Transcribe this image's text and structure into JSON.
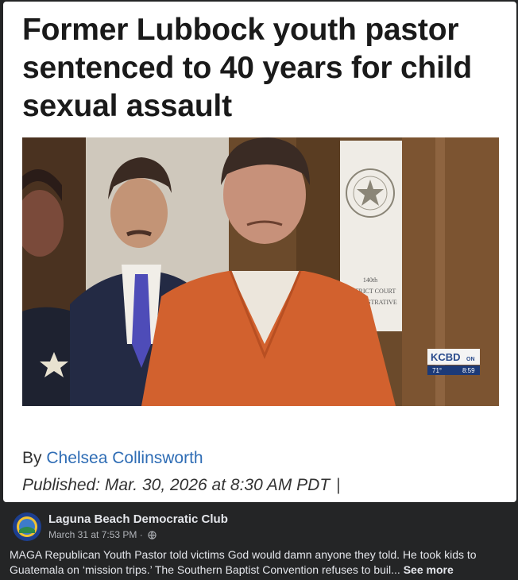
{
  "article": {
    "headline": "Former Lubbock youth pastor sentenced to 40 years for child sexual assault",
    "byline_prefix": "By",
    "author": "Chelsea Collinsworth",
    "published": "Published: Mar. 30, 2026 at 8:30 AM PDT",
    "published_separator": "|",
    "photo": {
      "station_logo": "KCBD",
      "station_logo_suffix": "ON",
      "temperature": "71°",
      "time": "8:59",
      "placard_text": [
        "140th",
        "DISTRICT COURT",
        "ADMINISTRATIVE"
      ]
    }
  },
  "post": {
    "page_name": "Laguna Beach Democratic Club",
    "timestamp": "March 31 at 7:53 PM",
    "separator": "·",
    "audience_icon": "globe-icon",
    "text": "MAGA Republican Youth Pastor told victims God would damn anyone they told. He took kids to Guatemala on ‘mission trips.’ The Southern Baptist Convention refuses to buil...",
    "see_more": "See more"
  },
  "colors": {
    "background": "#242526",
    "card": "#ffffff",
    "author_link": "#2f6db5",
    "jumpsuit": "#d2612e",
    "kcbd_blue": "#2a4b8c"
  }
}
